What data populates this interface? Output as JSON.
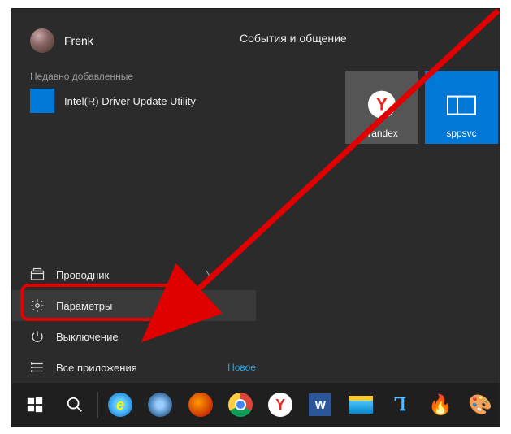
{
  "user": {
    "name": "Frenk"
  },
  "tiles_header": "События и общение",
  "recent": {
    "label": "Недавно добавленные",
    "items": [
      {
        "label": "Intel(R) Driver Update Utility"
      }
    ]
  },
  "tiles": [
    {
      "label": "Yandex",
      "icon": "yandex-icon",
      "color": "grey"
    },
    {
      "label": "sppsvc",
      "icon": "sppsvc-icon",
      "color": "blue"
    }
  ],
  "menu": {
    "explorer": "Проводник",
    "settings": "Параметры",
    "power": "Выключение",
    "all_apps": "Все приложения",
    "new_label": "Новое"
  },
  "taskbar_icons": [
    "start",
    "search",
    "divider",
    "ie",
    "srware",
    "firefox",
    "chrome",
    "yandex",
    "word",
    "explorer",
    "thunder",
    "burn",
    "paint"
  ],
  "annotation": {
    "highlight_target": "settings",
    "arrow_color": "#e00000"
  }
}
